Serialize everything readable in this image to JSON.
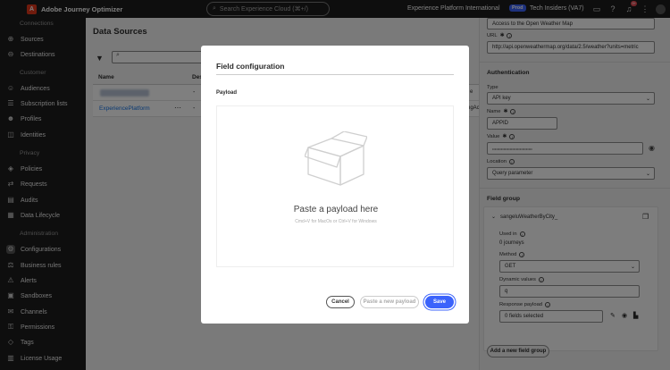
{
  "topbar": {
    "app_name": "Adobe Journey Optimizer",
    "search_placeholder": "Search Experience Cloud (⌘+/)",
    "org_name": "Experience Platform International",
    "env_badge": "Prod",
    "sandbox_name": "Tech Insiders (VA7)",
    "notification_count": "9+"
  },
  "sidebar": {
    "headings": [
      "Connections",
      "Customer",
      "Privacy",
      "Administration"
    ],
    "items": [
      {
        "label": "Sources",
        "icon": "sources-icon"
      },
      {
        "label": "Destinations",
        "icon": "destinations-icon"
      },
      {
        "label": "Audiences",
        "icon": "audiences-icon"
      },
      {
        "label": "Subscription lists",
        "icon": "subscription-icon"
      },
      {
        "label": "Profiles",
        "icon": "profiles-icon"
      },
      {
        "label": "Identities",
        "icon": "identities-icon"
      },
      {
        "label": "Policies",
        "icon": "policies-icon"
      },
      {
        "label": "Requests",
        "icon": "requests-icon"
      },
      {
        "label": "Audits",
        "icon": "audits-icon"
      },
      {
        "label": "Data Lifecycle",
        "icon": "data-lifecycle-icon"
      },
      {
        "label": "Configurations",
        "icon": "gear-icon"
      },
      {
        "label": "Business rules",
        "icon": "business-rules-icon"
      },
      {
        "label": "Alerts",
        "icon": "alerts-icon"
      },
      {
        "label": "Sandboxes",
        "icon": "sandboxes-icon"
      },
      {
        "label": "Channels",
        "icon": "channels-icon"
      },
      {
        "label": "Permissions",
        "icon": "permissions-icon"
      },
      {
        "label": "Tags",
        "icon": "tags-icon"
      },
      {
        "label": "License Usage",
        "icon": "license-icon"
      }
    ]
  },
  "main": {
    "title": "Data Sources",
    "col_name": "Name",
    "col_desc": "Des",
    "rows": [
      {
        "name": "",
        "desc": "-"
      },
      {
        "name": "ExperiencePlatform",
        "desc": "-"
      }
    ],
    "overflow_partial_1": "e",
    "overflow_partial_2": "ngAc"
  },
  "rpanel": {
    "description_value": "Access to the Open Weather Map",
    "url_label": "URL",
    "url_value": "http://api.openweathermap.org/data/2.5/weather?units=metric",
    "auth_title": "Authentication",
    "type_label": "Type",
    "type_value": "API key",
    "name_label": "Name",
    "name_value": "APPID",
    "value_label": "Value",
    "value_value": "••••••••••••••••••••••••••••••••",
    "location_label": "Location",
    "location_value": "Query parameter",
    "field_group_title": "Field group",
    "field_group_name": "sangeluWeatherByCity_",
    "used_in_label": "Used in",
    "used_in_value": "0 journeys",
    "method_label": "Method",
    "method_value": "GET",
    "dynamic_label": "Dynamic values",
    "dynamic_value": "q",
    "payload_label": "Response payload",
    "payload_value": "0 fields selected",
    "add_group_button": "Add a new field group"
  },
  "modal": {
    "title": "Field configuration",
    "payload_label": "Payload",
    "dropzone_title": "Paste a payload here",
    "dropzone_hint": "Cmd+V for MacOs or Ctrl+V for Windows",
    "cancel_label": "Cancel",
    "paste_label": "Paste a new payload",
    "save_label": "Save"
  },
  "colors": {
    "accent": "#3b63fb",
    "brand": "#e0371b",
    "chrome": "#1c1c1c"
  }
}
